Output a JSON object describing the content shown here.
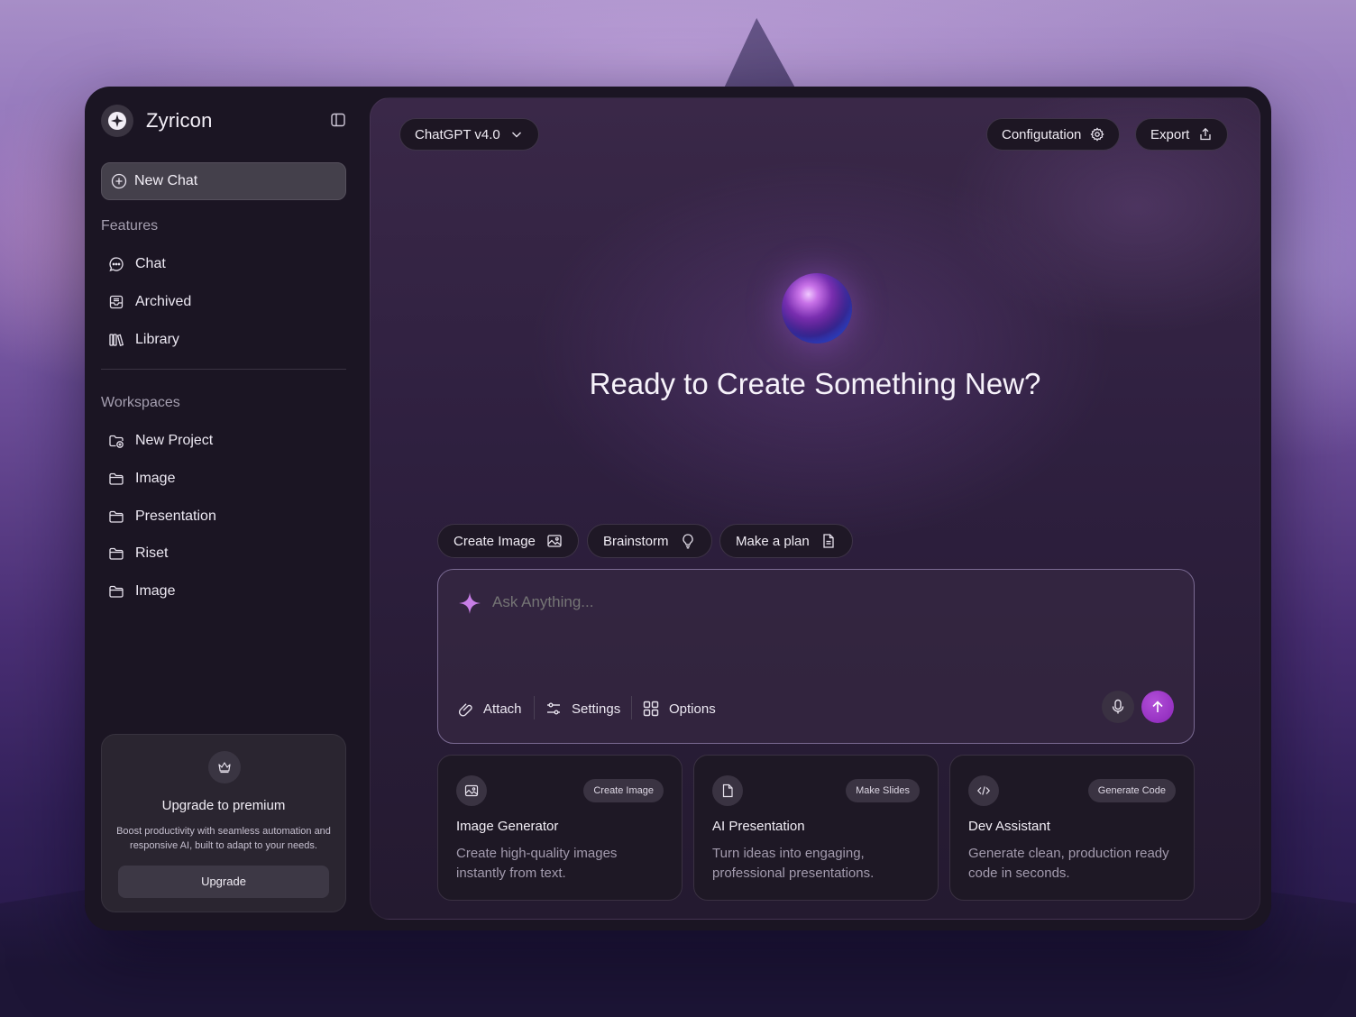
{
  "app": {
    "name": "Zyricon"
  },
  "sidebar": {
    "new_chat_label": "New Chat",
    "features_label": "Features",
    "features": [
      {
        "label": "Chat",
        "icon": "chat-bubble-icon"
      },
      {
        "label": "Archived",
        "icon": "archive-icon"
      },
      {
        "label": "Library",
        "icon": "library-icon"
      }
    ],
    "workspaces_label": "Workspaces",
    "workspaces": [
      {
        "label": "New Project",
        "icon": "folder-plus-icon"
      },
      {
        "label": "Image",
        "icon": "folder-icon"
      },
      {
        "label": "Presentation",
        "icon": "folder-icon"
      },
      {
        "label": "Riset",
        "icon": "folder-icon"
      },
      {
        "label": "Image",
        "icon": "folder-icon"
      }
    ],
    "upgrade": {
      "title": "Upgrade to premium",
      "description": "Boost productivity with seamless automation and responsive AI, built to adapt to your needs.",
      "button_label": "Upgrade"
    }
  },
  "header": {
    "model_selector": "ChatGPT v4.0",
    "configuration_label": "Configutation",
    "export_label": "Export"
  },
  "hero": {
    "headline": "Ready to Create Something New?"
  },
  "quick_actions": [
    {
      "label": "Create Image",
      "icon": "image-icon"
    },
    {
      "label": "Brainstorm",
      "icon": "lightbulb-icon"
    },
    {
      "label": "Make a plan",
      "icon": "document-icon"
    }
  ],
  "composer": {
    "placeholder": "Ask Anything...",
    "tools": [
      {
        "label": "Attach",
        "icon": "paperclip-icon"
      },
      {
        "label": "Settings",
        "icon": "sliders-icon"
      },
      {
        "label": "Options",
        "icon": "grid-icon"
      }
    ]
  },
  "cards": [
    {
      "tag": "Create Image",
      "title": "Image Generator",
      "description": "Create high-quality images instantly from text.",
      "icon": "image-icon"
    },
    {
      "tag": "Make Slides",
      "title": "AI Presentation",
      "description": "Turn ideas into engaging, professional presentations.",
      "icon": "file-icon"
    },
    {
      "tag": "Generate Code",
      "title": "Dev Assistant",
      "description": "Generate clean, production ready code in seconds.",
      "icon": "code-icon"
    }
  ],
  "colors": {
    "accent": "#9a35c8",
    "panel": "#1b1523",
    "main_bg": "#2f2040"
  }
}
